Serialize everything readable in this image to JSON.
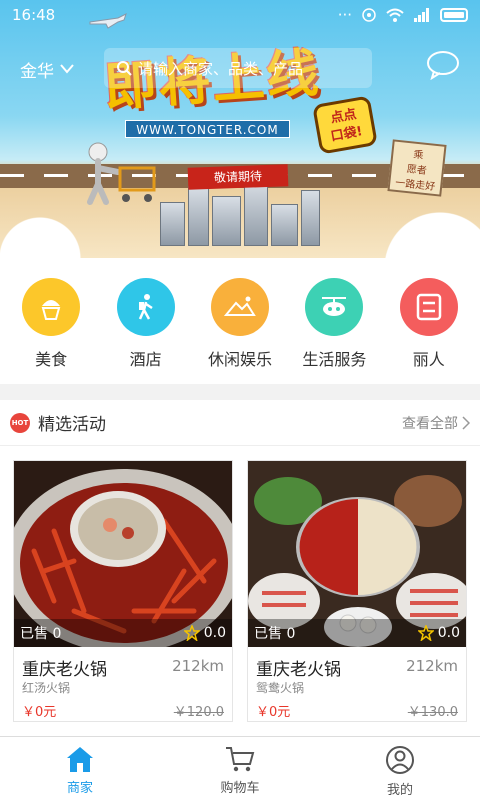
{
  "status": {
    "time": "16:48"
  },
  "header": {
    "city": "金华",
    "search_placeholder": "请输入商家、品类、产品"
  },
  "banner": {
    "headline": "即将上线",
    "url": "WWW.TONGTER.COM",
    "badge_line1": "点点",
    "badge_line2": "口袋!",
    "ribbon": "敬请期待",
    "sign_line1": "乘",
    "sign_line2": "愿者",
    "sign_line3": "一路走好"
  },
  "categories": [
    {
      "label": "美食",
      "color": "#fcc72a"
    },
    {
      "label": "酒店",
      "color": "#2fc6e8"
    },
    {
      "label": "休闲娱乐",
      "color": "#f9b03b"
    },
    {
      "label": "生活服务",
      "color": "#3dd1b4"
    },
    {
      "label": "丽人",
      "color": "#f45d5d"
    }
  ],
  "section": {
    "hot_badge": "HOT",
    "title": "精选活动",
    "see_all": "查看全部"
  },
  "products": [
    {
      "sold": "已售 0",
      "rating": "0.0",
      "name": "重庆老火锅",
      "distance": "212km",
      "subtitle": "红汤火锅",
      "price": "￥0元",
      "original_price": "￥120.0"
    },
    {
      "sold": "已售 0",
      "rating": "0.0",
      "name": "重庆老火锅",
      "distance": "212km",
      "subtitle": "鸳鸯火锅",
      "price": "￥0元",
      "original_price": "￥130.0"
    }
  ],
  "tabs": [
    {
      "label": "商家",
      "active": true
    },
    {
      "label": "购物车",
      "active": false
    },
    {
      "label": "我的",
      "active": false
    }
  ],
  "colors": {
    "accent": "#1a9be8",
    "price": "#e8362a",
    "hot": "#e8453c"
  }
}
